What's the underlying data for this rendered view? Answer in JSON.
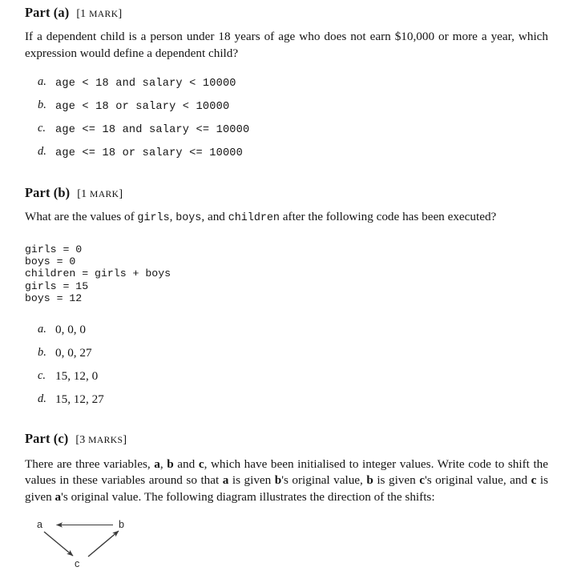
{
  "document": {
    "parts": [
      {
        "heading": "Part (a)",
        "marks_open": "[1 ",
        "marks_word": "MARK",
        "marks_close": "]",
        "question_lead": "If a dependent child is a person under 18 years of age who does not earn $10,000 or more a year, which expression would define a dependent child?",
        "options": [
          {
            "label": "a.",
            "text": "age < 18 and salary < 10000"
          },
          {
            "label": "b.",
            "text": "age < 18 or salary < 10000"
          },
          {
            "label": "c.",
            "text": "age <= 18 and salary <= 10000"
          },
          {
            "label": "d.",
            "text": "age <= 18 or salary <= 10000"
          }
        ]
      },
      {
        "heading": "Part (b)",
        "marks_open": "[1 ",
        "marks_word": "MARK",
        "marks_close": "]",
        "q_seg1": "What are the values of ",
        "q_var1": "girls",
        "q_seg2": ", ",
        "q_var2": "boys",
        "q_seg3": ", and ",
        "q_var3": "children",
        "q_seg4": " after the following code has been executed?",
        "code": "girls = 0\nboys = 0\nchildren = girls + boys\ngirls = 15\nboys = 12",
        "options": [
          {
            "label": "a.",
            "text": "0, 0, 0"
          },
          {
            "label": "b.",
            "text": "0, 0, 27"
          },
          {
            "label": "c.",
            "text": "15, 12, 0"
          },
          {
            "label": "d.",
            "text": "15, 12, 27"
          }
        ]
      },
      {
        "heading": "Part (c)",
        "marks_open": "[3 ",
        "marks_word": "MARKS",
        "marks_close": "]",
        "p_seg1": "There are three variables, ",
        "p_var1": "a",
        "p_seg2": ", ",
        "p_var2": "b",
        "p_seg3": " and ",
        "p_var3": "c",
        "p_seg4": ", which have been initialised to integer values. Write code to shift the values in these variables around so that ",
        "p_var4": "a",
        "p_seg5": " is given ",
        "p_var5": "b",
        "p_seg6": "'s original value, ",
        "p_var6": "b",
        "p_seg7": " is given ",
        "p_var7": "c",
        "p_seg8": "'s original value, and ",
        "p_var8": "c",
        "p_seg9": " is given ",
        "p_var9": "a",
        "p_seg10": "'s original value. The following diagram illustrates the direction of the shifts:",
        "diagram": {
          "nodes": [
            {
              "name": "a",
              "label": "a"
            },
            {
              "name": "b",
              "label": "b"
            },
            {
              "name": "c",
              "label": "c"
            }
          ],
          "edges": [
            {
              "from": "b",
              "to": "a"
            },
            {
              "from": "a",
              "to": "c"
            },
            {
              "from": "c",
              "to": "b"
            }
          ],
          "stroke_color": "#3a3a3a"
        }
      }
    ]
  }
}
